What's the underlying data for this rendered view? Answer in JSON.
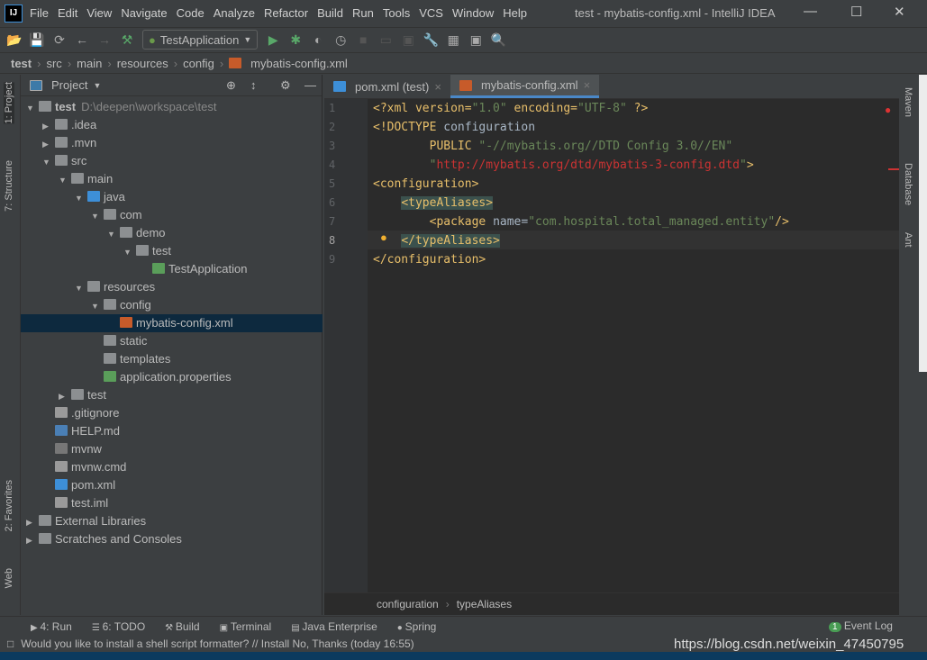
{
  "window": {
    "title": "test - mybatis-config.xml - IntelliJ IDEA",
    "logo": "IJ",
    "menu": [
      "File",
      "Edit",
      "View",
      "Navigate",
      "Code",
      "Analyze",
      "Refactor",
      "Build",
      "Run",
      "Tools",
      "VCS",
      "Window",
      "Help"
    ]
  },
  "toolbar": {
    "run_config": "TestApplication"
  },
  "breadcrumb": [
    "test",
    "src",
    "main",
    "resources",
    "config",
    "mybatis-config.xml"
  ],
  "left_strip": [
    "1: Project",
    "7: Structure",
    "2: Favorites",
    "Web"
  ],
  "project": {
    "title": "Project",
    "tree": [
      {
        "label": "test",
        "extra": "D:\\deepen\\workspace\\test",
        "level": 0,
        "arrow": "open",
        "icon": "folder",
        "bold": true
      },
      {
        "label": ".idea",
        "level": 1,
        "arrow": "closed",
        "icon": "folder"
      },
      {
        "label": ".mvn",
        "level": 1,
        "arrow": "closed",
        "icon": "folder"
      },
      {
        "label": "src",
        "level": 1,
        "arrow": "open",
        "icon": "folder"
      },
      {
        "label": "main",
        "level": 2,
        "arrow": "open",
        "icon": "folder"
      },
      {
        "label": "java",
        "level": 3,
        "arrow": "open",
        "icon": "folder-blue"
      },
      {
        "label": "com",
        "level": 4,
        "arrow": "open",
        "icon": "folder"
      },
      {
        "label": "demo",
        "level": 5,
        "arrow": "open",
        "icon": "folder"
      },
      {
        "label": "test",
        "level": 6,
        "arrow": "open",
        "icon": "folder"
      },
      {
        "label": "TestApplication",
        "level": 7,
        "arrow": "none",
        "icon": "spring-class"
      },
      {
        "label": "resources",
        "level": 3,
        "arrow": "open",
        "icon": "folder-res"
      },
      {
        "label": "config",
        "level": 4,
        "arrow": "open",
        "icon": "folder"
      },
      {
        "label": "mybatis-config.xml",
        "level": 5,
        "arrow": "none",
        "icon": "xml",
        "selected": true
      },
      {
        "label": "static",
        "level": 4,
        "arrow": "none",
        "icon": "folder"
      },
      {
        "label": "templates",
        "level": 4,
        "arrow": "none",
        "icon": "folder"
      },
      {
        "label": "application.properties",
        "level": 4,
        "arrow": "none",
        "icon": "spring-props"
      },
      {
        "label": "test",
        "level": 2,
        "arrow": "closed",
        "icon": "folder"
      },
      {
        "label": ".gitignore",
        "level": 1,
        "arrow": "none",
        "icon": "file"
      },
      {
        "label": "HELP.md",
        "level": 1,
        "arrow": "none",
        "icon": "md"
      },
      {
        "label": "mvnw",
        "level": 1,
        "arrow": "none",
        "icon": "shell"
      },
      {
        "label": "mvnw.cmd",
        "level": 1,
        "arrow": "none",
        "icon": "file"
      },
      {
        "label": "pom.xml",
        "level": 1,
        "arrow": "none",
        "icon": "maven"
      },
      {
        "label": "test.iml",
        "level": 1,
        "arrow": "none",
        "icon": "file"
      },
      {
        "label": "External Libraries",
        "level": 0,
        "arrow": "closed",
        "icon": "libs"
      },
      {
        "label": "Scratches and Consoles",
        "level": 0,
        "arrow": "closed",
        "icon": "scratch"
      }
    ]
  },
  "editor": {
    "tabs": [
      {
        "label": "pom.xml (test)",
        "active": false
      },
      {
        "label": "mybatis-config.xml",
        "active": true
      }
    ],
    "lines": [
      "1",
      "2",
      "3",
      "4",
      "5",
      "6",
      "7",
      "8",
      "9"
    ],
    "breadcrumb": [
      "configuration",
      "typeAliases"
    ]
  },
  "right_strip": [
    "Maven",
    "Database",
    "Ant"
  ],
  "bottom_tools": [
    "4: Run",
    "6: TODO",
    "Build",
    "Terminal",
    "Java Enterprise",
    "Spring"
  ],
  "event_log": {
    "label": "Event Log",
    "count": "1"
  },
  "status": {
    "message": "Would you like to install a shell script formatter? // Install   No, Thanks (today 16:55)",
    "right": "https://blog.csdn.net/weixin_47450795"
  },
  "colors": {
    "accent": "#4a88c7",
    "selection": "#0d293e",
    "tag": "#e8bf6a",
    "string": "#6a8759",
    "url": "#cc3333"
  }
}
